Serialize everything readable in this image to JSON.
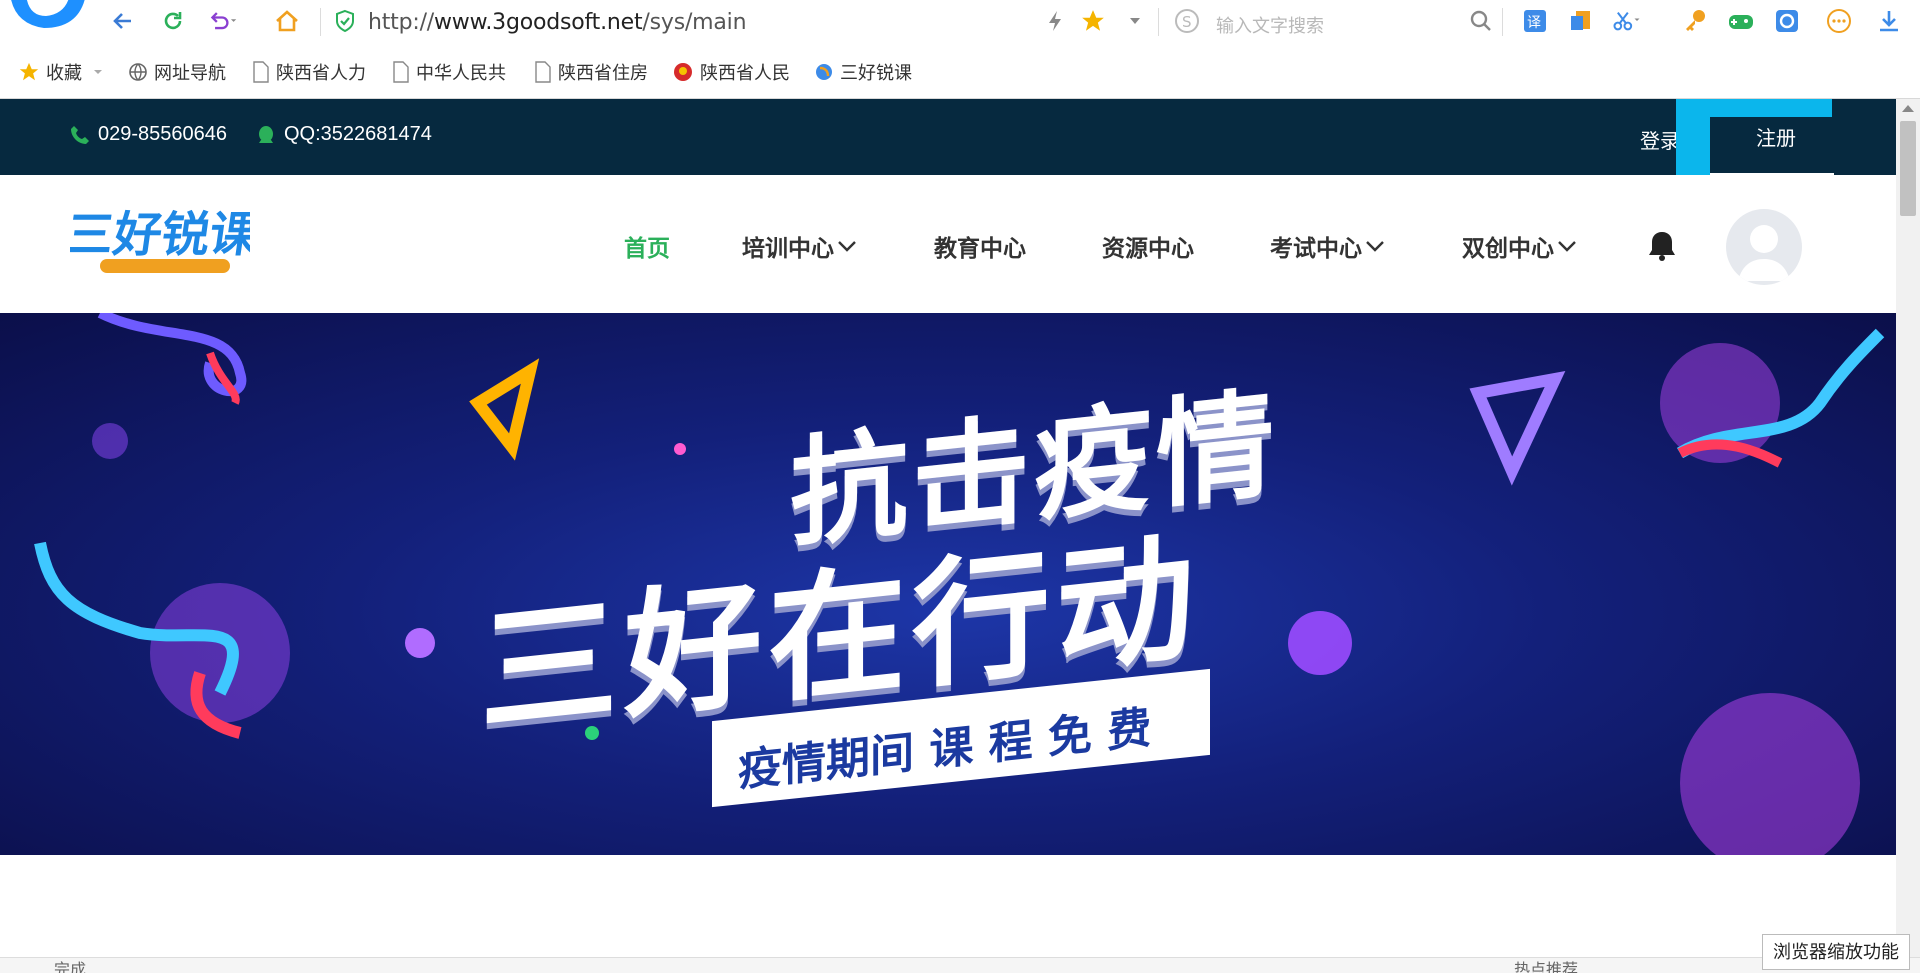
{
  "browser": {
    "url_scheme": "http://",
    "url_host": "www.3goodsoft.net",
    "url_path": "/sys/main",
    "search_placeholder": "输入文字搜索",
    "bookmarks": [
      "收藏",
      "网址导航",
      "陕西省人力",
      "中华人民共",
      "陕西省住房",
      "陕西省人民",
      "三好锐课"
    ],
    "status_text": "完成",
    "hot_text": "热点推荐",
    "zoom_tooltip": "浏览器缩放功能"
  },
  "site": {
    "topbar": {
      "phone": "029-85560646",
      "qq": "QQ:3522681474",
      "login_label": "登录",
      "register_label": "注册"
    },
    "nav": {
      "items": [
        "首页",
        "培训中心",
        "教育中心",
        "资源中心",
        "考试中心",
        "双创中心"
      ],
      "active_index": 0
    },
    "banner": {
      "title_line1": "抗击疫情",
      "title_line2": "三好在行动",
      "subtitle": "疫情期间 课 程 免 费"
    }
  },
  "colors": {
    "topbar_bg": "#06293f",
    "nav_active": "#2bb05a",
    "highlight": "#0bb6ec",
    "banner_bg": "#13207a"
  }
}
